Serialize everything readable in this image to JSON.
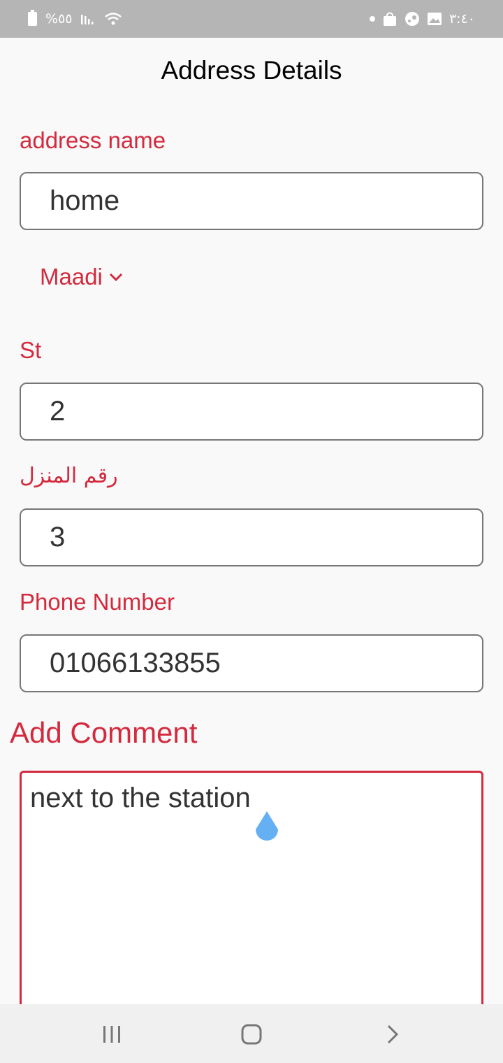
{
  "status_bar": {
    "battery_text": "%٥٥",
    "time": "٣:٤٠",
    "icons": [
      "battery-charging-icon",
      "signal-icon",
      "wifi-icon",
      "dot-icon",
      "shopping-bag-icon",
      "steam-icon",
      "image-icon"
    ]
  },
  "header": {
    "title": "Address Details"
  },
  "form": {
    "address_name": {
      "label": "address name",
      "value": "home"
    },
    "area": {
      "selected": "Maadi"
    },
    "street": {
      "label": "St",
      "value": "2"
    },
    "house_number": {
      "label": "رقم المنزل",
      "value": "3"
    },
    "phone": {
      "label": "Phone Number",
      "value": "01066133855"
    },
    "comment": {
      "label": "Add Comment",
      "value": "next to the station"
    }
  },
  "colors": {
    "accent": "#d32a3e",
    "cursor_handle": "#64b0f2",
    "status_bar": "#b5b5b5"
  },
  "nav_bar": {
    "icons": [
      "recent-apps-icon",
      "home-icon",
      "back-icon"
    ]
  }
}
